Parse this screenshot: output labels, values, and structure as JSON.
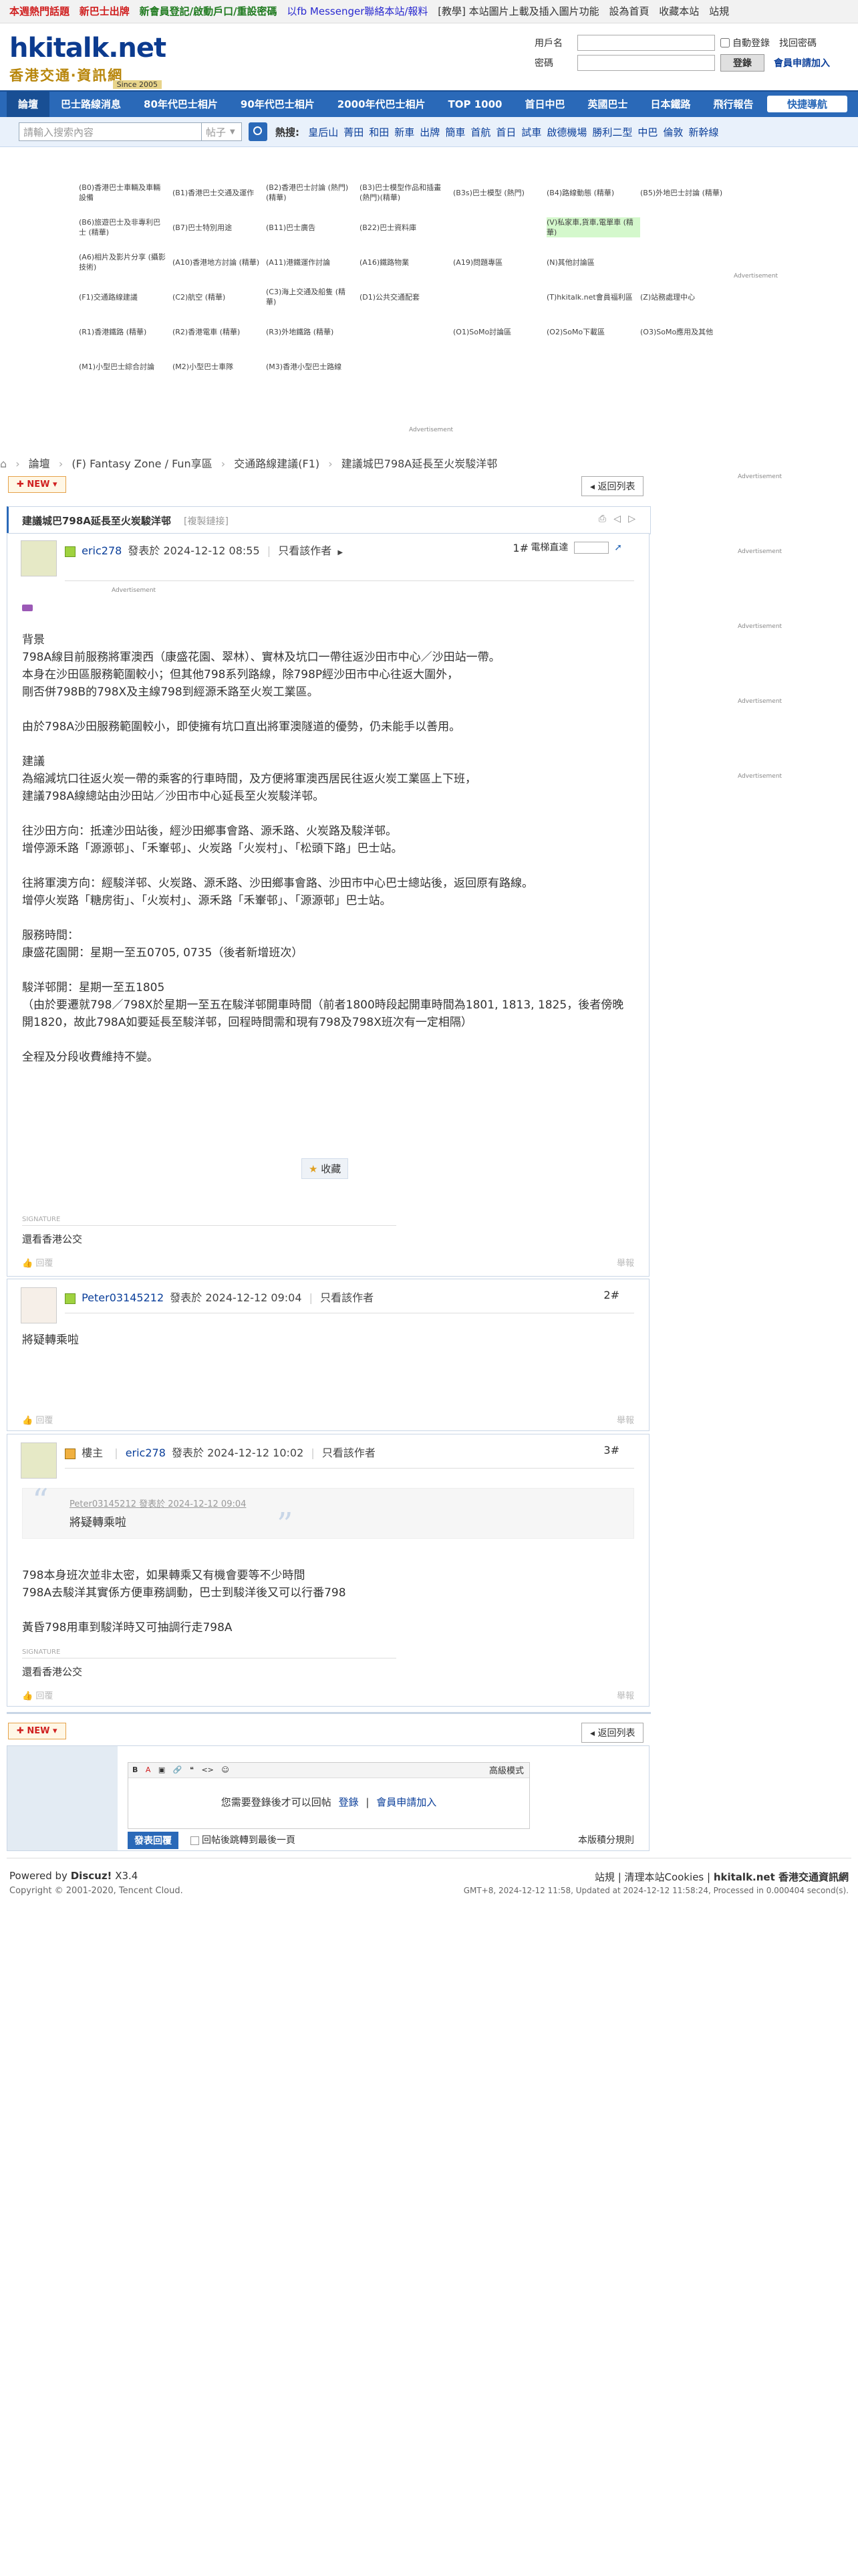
{
  "topbar": {
    "items": [
      "本週熱門話題",
      "新巴士出牌",
      "新會員登記/啟動戶口/重設密碼",
      "以fb Messenger聯絡本站/報料",
      "[教學] 本站圖片上載及插入圖片功能",
      "設為首頁",
      "收藏本站",
      "站規"
    ]
  },
  "logo": {
    "name": "hkitalk.net",
    "tagline": "香港交通‧資訊網",
    "since": "Since 2005"
  },
  "login": {
    "user_label": "用戶名",
    "pw_label": "密碼",
    "auto_login": "自動登錄",
    "find_pw": "找回密碼",
    "login_btn": "登錄",
    "register": "會員申請加入"
  },
  "nav": {
    "items": [
      "論壇",
      "巴士路線消息",
      "80年代巴士相片",
      "90年代巴士相片",
      "2000年代巴士相片",
      "TOP 1000",
      "首日中巴",
      "英國巴士",
      "日本鐵路",
      "飛行報告"
    ],
    "quick": "快捷導航"
  },
  "search": {
    "placeholder": "請輸入搜索內容",
    "type": "帖子",
    "hot_label": "熱搜:",
    "hot_terms": [
      "皇后山",
      "菁田",
      "和田",
      "新車",
      "出牌",
      "簡車",
      "首航",
      "首日",
      "試車",
      "啟德機場",
      "勝利二型",
      "中巴",
      "倫敦",
      "新幹線"
    ]
  },
  "forum_grid": [
    [
      "(B0)香港巴士車輛及車輛設備",
      "(B1)香港巴士交通及運作",
      "(B2)香港巴士討論 (熱門) (精華)",
      "(B3)巴士模型作品和插畫 (熱門)(精華)",
      "(B3s)巴士模型 (熱門)",
      "(B4)路線動態 (精華)",
      "(B5)外地巴士討論 (精華)"
    ],
    [
      "(B6)旅遊巴士及非專利巴士 (精華)",
      "(B7)巴士特別用途",
      "(B11)巴士廣告",
      "(B22)巴士資料庫",
      "",
      "(V)私家車,貨車,電單車 (精華)",
      ""
    ],
    [
      "(A6)相片及影片分享 (攝影技術)",
      "(A10)香港地方討論 (精華)",
      "(A11)港鐵運作討論",
      "(A16)鐵路物業",
      "(A19)問題專區",
      "(N)其他討論區",
      ""
    ],
    [
      "(F1)交通路線建議",
      "(C2)航空 (精華)",
      "(C3)海上交通及船隻 (精華)",
      "(D1)公共交通配套",
      "",
      "(T)hkitalk.net會員福利區",
      "(Z)站務處理中心"
    ],
    [
      "(R1)香港鐵路 (精華)",
      "(R2)香港電車 (精華)",
      "(R3)外地鐵路 (精華)",
      "",
      "(O1)SoMo討論區",
      "(O2)SoMo下載區",
      "(O3)SoMo應用及其他"
    ],
    [
      "(M1)小型巴士綜合討論",
      "(M2)小型巴士車隊",
      "(M3)香港小型巴士路線",
      "",
      "",
      "",
      ""
    ]
  ],
  "ad_label": "Advertisement",
  "breadcrumb": [
    "論壇",
    "(F) Fantasy Zone / Fun享區",
    "交通路線建議(F1)",
    "建議城巴798A延長至火炭駿洋邨"
  ],
  "buttons": {
    "new": "NEW",
    "return": "返回列表",
    "collect": "收藏",
    "reply": "回覆",
    "report": "舉報",
    "submit": "發表回覆",
    "after_reply": "回帖後跳轉到最後一頁",
    "rules": "本版積分規則",
    "admin_mode": "高級模式"
  },
  "thread": {
    "title": "建議城巴798A延長至火炭駿洋邨",
    "copy": "[複製鏈接]"
  },
  "posts": [
    {
      "author": "eric278",
      "time": "發表於 2024-12-12 08:55",
      "only": "只看該作者",
      "floor": "1#",
      "jump": "電梯直達",
      "lines": [
        "背景",
        "798A線目前服務將軍澳西（康盛花園、翠林）、實林及坑口一帶往返沙田市中心／沙田站一帶。",
        "本身在沙田區服務範圍較小；但其他798系列路線，除798P經沙田市中心往返大圍外，",
        "剛否併798B的798X及主線798到經源禾路至火炭工業區。",
        "",
        "由於798A沙田服務範圍較小，即使擁有坑口直出將軍澳隧道的優勢，仍未能手以善用。",
        "",
        "建議",
        "為縮減坑口往返火炭一帶的乘客的行車時間，及方便將軍澳西居民往返火炭工業區上下班，",
        "建議798A線總站由沙田站／沙田市中心延長至火炭駿洋邨。",
        "",
        "往沙田方向：抵達沙田站後，經沙田鄉事會路、源禾路、火炭路及駿洋邨。",
        "增停源禾路「源源邨」、「禾輋邨」、火炭路「火炭村」、「松頭下路」巴士站。",
        "",
        "往將軍澳方向：經駿洋邨、火炭路、源禾路、沙田鄉事會路、沙田市中心巴士總站後，返回原有路線。",
        "增停火炭路「糖房街」、「火炭村」、源禾路「禾輋邨」、「源源邨」巴士站。",
        "",
        "服務時間：",
        "康盛花園開：星期一至五0705, 0735（後者新增班次）",
        "",
        "駿洋邨開：星期一至五1805",
        "（由於要遷就798／798X於星期一至五在駿洋邨開車時間（前者1800時段起開車時間為1801, 1813, 1825，後者傍晚開1820，故此798A如要延長至駿洋邨，回程時間需和現有798及798X班次有一定相隔）",
        "",
        "全程及分段收費維持不變。"
      ],
      "sig_label": "SIGNATURE",
      "sig": "還看香港公交"
    },
    {
      "author": "Peter03145212",
      "time": "發表於 2024-12-12 09:04",
      "only": "只看該作者",
      "floor": "2#",
      "lines": [
        "將疑轉乘啦"
      ]
    },
    {
      "role": "樓主",
      "author": "eric278",
      "time": "發表於 2024-12-12 10:02",
      "only": "只看該作者",
      "floor": "3#",
      "quote_author": "Peter03145212 發表於 2024-12-12 09:04",
      "quote": "將疑轉乘啦",
      "lines": [
        "798本身班次並非太密，如果轉乘又有機會要等不少時間",
        "798A去駿洋其實係方便車務調動，巴士到駿洋後又可以行番798",
        "",
        "黃昏798用車到駿洋時又可抽調行走798A"
      ],
      "sig_label": "SIGNATURE",
      "sig": "還看香港公交"
    }
  ],
  "reply_box": {
    "need_login": "您需要登錄後才可以回帖",
    "login": "登錄",
    "register": "會員申請加入"
  },
  "footer": {
    "powered": "Powered by",
    "discuz": "Discuz!",
    "version": "X3.4",
    "copyright": "Copyright © 2001-2020, Tencent Cloud.",
    "links": [
      "站規",
      "清理本站Cookies",
      "hkitalk.net 香港交通資訊網"
    ],
    "time": "GMT+8, 2024-12-12 11:58, Updated at 2024-12-12 11:58:24, Processed in 0.000404 second(s)."
  },
  "colors": {
    "nav": "#2a69b8",
    "link": "#0b3f9a",
    "hot": "#d02020",
    "highlight": "#d4f8cc"
  }
}
